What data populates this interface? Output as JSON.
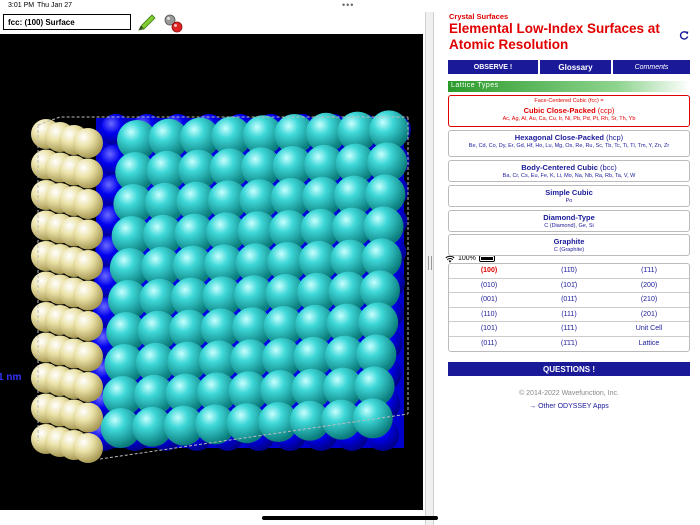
{
  "status": {
    "time": "3:01 PM",
    "date": "Thu Jan 27",
    "battery": "100%"
  },
  "viewer": {
    "title": "fcc: (100) Surface",
    "scale_label": "1 nm"
  },
  "app": {
    "subtitle": "Crystal Surfaces",
    "title": "Elemental Low-Index Surfaces at Atomic Resolution"
  },
  "tabs": {
    "observe": "OBSERVE !",
    "glossary": "Glossary",
    "comments": "Comments"
  },
  "section": {
    "lattice_types": "Lattice Types"
  },
  "lattices": [
    {
      "pre": "Face-Centered Cubic (fcc) =",
      "name": "Cubic Close-Packed",
      "abbr": "(ccp)",
      "elements": "Ac, Ag, Al, Au, Ca, Cu, Ir, Ni, Pb, Pd, Pt, Rh, Sr, Th, Yb"
    },
    {
      "name": "Hexagonal Close-Packed",
      "abbr": "(hcp)",
      "elements": "Be, Cd, Co, Dy, Er, Gd, Hf, Ho, Lu, Mg, Os, Re, Ru, Sc, Tb, Tc, Ti, Tl, Tm, Y, Zn, Zr"
    },
    {
      "name": "Body-Centered Cubic",
      "abbr": "(bcc)",
      "elements": "Ba, Cr, Cs, Eu, Fe, K, Li, Mo, Na, Nb, Ra, Rb, Ta, V, W"
    },
    {
      "name": "Simple Cubic",
      "elements": "Po"
    },
    {
      "name": "Diamond-Type",
      "elements": "C (Diamond), Ge, Si"
    },
    {
      "name": "Graphite",
      "elements": "C (Graphite)"
    }
  ],
  "surfaces": [
    [
      "(100)",
      "(11̄0)",
      "(1̄11)"
    ],
    [
      "(010)",
      "(101̄)",
      "(200)"
    ],
    [
      "(001)",
      "(011̄)",
      "(210)"
    ],
    [
      "(110)",
      "(111)",
      "(201)"
    ],
    [
      "(101)",
      "(11̄1)",
      "Unit Cell"
    ],
    [
      "(011)",
      "(1̄1̄1)",
      "Lattice"
    ]
  ],
  "footer": {
    "questions": "QUESTIONS !",
    "copyright": "© 2014-2022  Wavefunction, Inc.",
    "other_apps": "→ Other ODYSSEY Apps"
  },
  "colors": {
    "accent_red": "#e00000",
    "nav_blue": "#1a1a99",
    "surface_atom": "#2ec4c4",
    "bulk_atom": "#0000dd",
    "side_atom": "#e8dfa0"
  }
}
